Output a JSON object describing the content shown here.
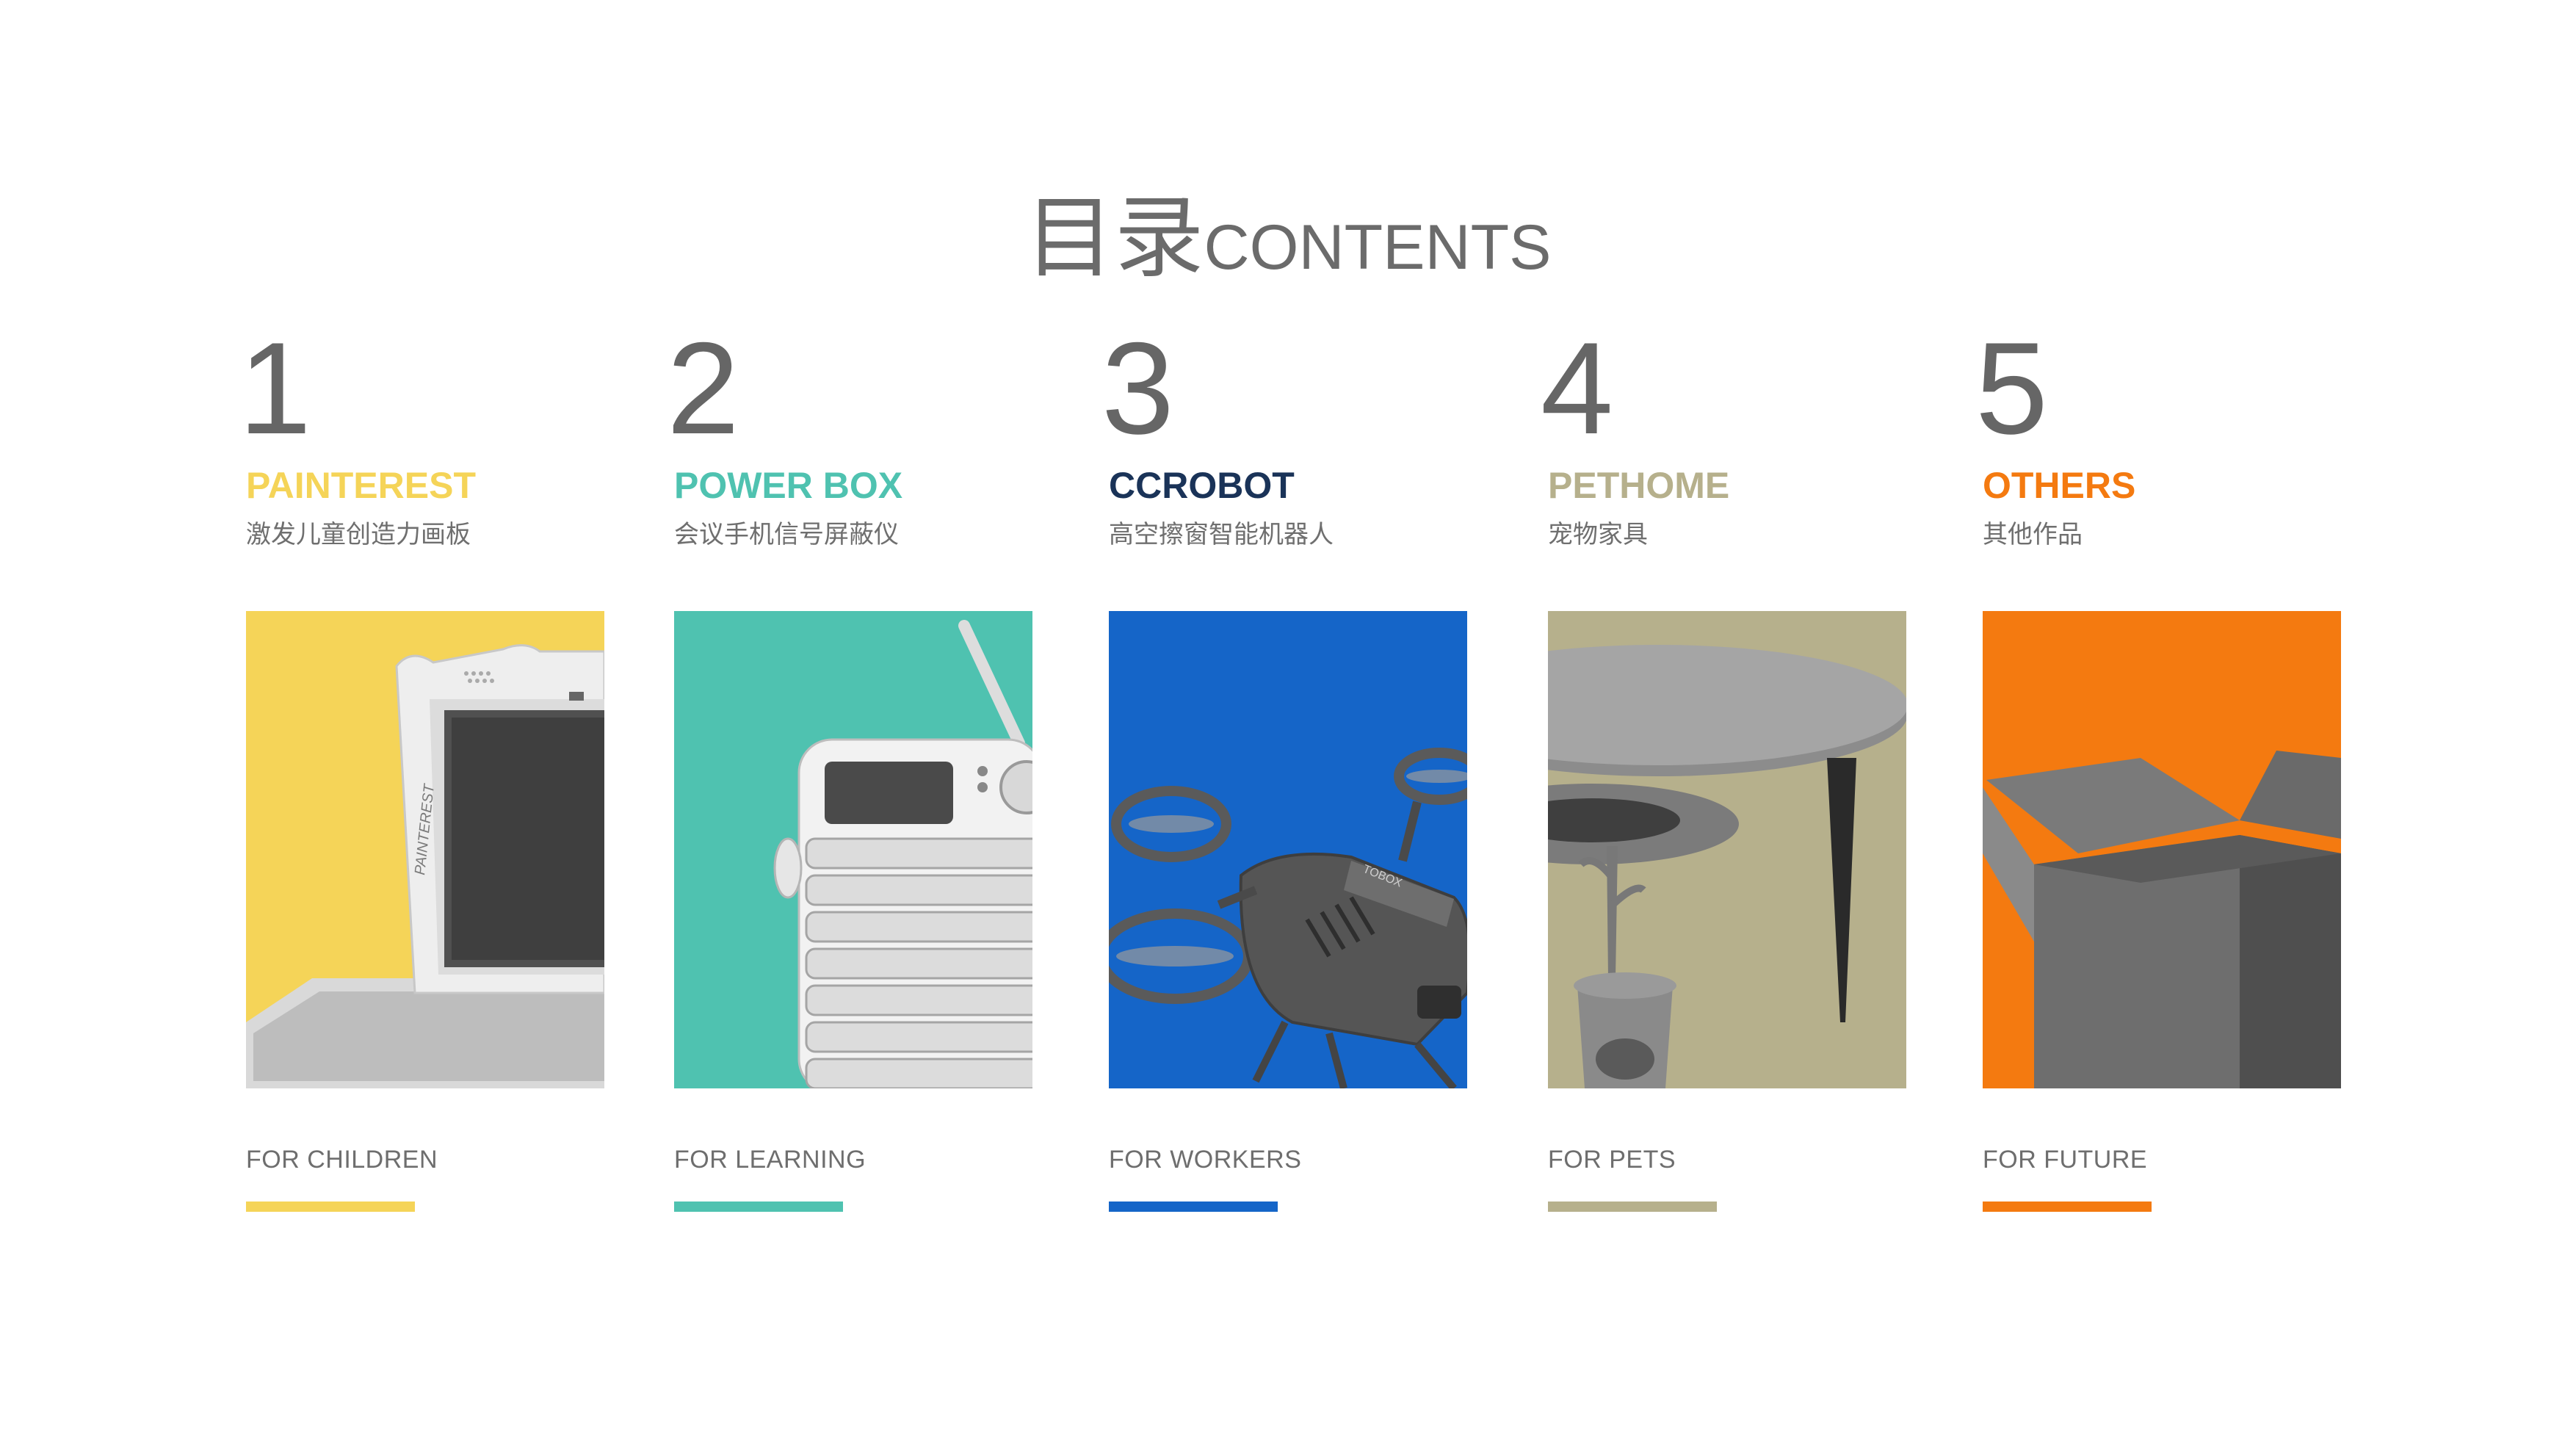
{
  "page": {
    "title_cn": "目录",
    "title_en": "CONTENTS"
  },
  "sections": [
    {
      "number": "1",
      "name": "PAINTEREST",
      "subtitle": "激发儿童创造力画板",
      "footer": "FOR CHILDREN",
      "color": "#f5d458",
      "image_label": "PAINTEREST",
      "icon": "drawing-tablet-image"
    },
    {
      "number": "2",
      "name": "POWER BOX",
      "subtitle": "会议手机信号屏蔽仪",
      "footer": "FOR LEARNING",
      "color": "#4fc2b0",
      "image_label": "",
      "icon": "signal-box-image"
    },
    {
      "number": "3",
      "name": "CCROBOT",
      "subtitle": "高空擦窗智能机器人",
      "footer": "FOR WORKERS",
      "color": "#1565c8",
      "name_color": "#1a3358",
      "image_label": "TOBOX",
      "icon": "drone-robot-image"
    },
    {
      "number": "4",
      "name": "PETHOME",
      "subtitle": "宠物家具",
      "footer": "FOR PETS",
      "color": "#b6b08c",
      "image_label": "",
      "icon": "pet-table-image"
    },
    {
      "number": "5",
      "name": "OTHERS",
      "subtitle": "其他作品",
      "footer": "FOR FUTURE",
      "color": "#f47a10",
      "image_label": "",
      "icon": "open-box-image"
    }
  ]
}
